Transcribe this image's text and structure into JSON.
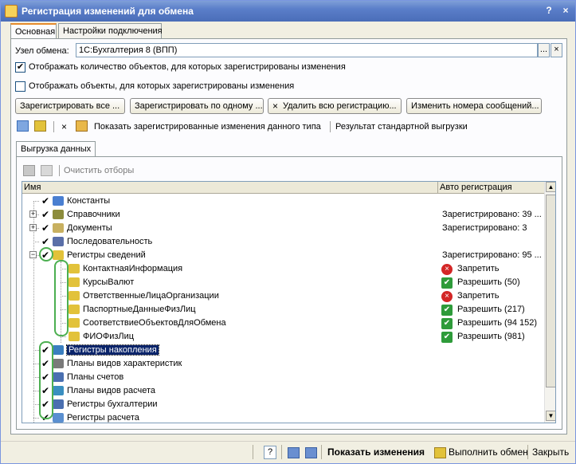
{
  "window": {
    "title": "Регистрация изменений для обмена",
    "controls": [
      "?",
      "×"
    ]
  },
  "tabs": [
    {
      "label": "Основная",
      "active": true
    },
    {
      "label": "Настройки подключения",
      "active": false
    }
  ],
  "main": {
    "node_label": "Узел обмена:",
    "node_value": "1С:Бухгалтерия 8 (ВПП)",
    "node_select_glyph": "...",
    "node_clear_glyph": "×",
    "chk_show_count": {
      "label": "Отображать количество объектов, для которых зарегистрированы изменения",
      "checked": true
    },
    "chk_show_objects": {
      "label": "Отображать объекты, для которых зарегистрированы изменения",
      "checked": false
    },
    "buttons": {
      "register_all": "Зарегистрировать все ...",
      "register_one": "Зарегистрировать по одному ...",
      "delete_all": "Удалить всю регистрацию...",
      "change_numbers": "Изменить номера сообщений..."
    },
    "toolbar2": {
      "delete_glyph": "×",
      "show_registered": "Показать зарегистрированные изменения данного типа",
      "std_result": "Результат стандартной выгрузки"
    },
    "subtab_label": "Выгрузка данных",
    "clear_filters": "Очистить отборы",
    "grid": {
      "col_name": "Имя",
      "col_auto": "Авто регистрация",
      "rows": [
        {
          "name": "Константы",
          "status": "",
          "level": 0,
          "expander": "",
          "icon_color": "#4a7fd1"
        },
        {
          "name": "Справочники",
          "status": "Зарегистрировано: 39 ...",
          "level": 0,
          "expander": "+",
          "icon_color": "#8c8c3c"
        },
        {
          "name": "Документы",
          "status": "Зарегистрировано: 3",
          "level": 0,
          "expander": "+",
          "icon_color": "#c8b060"
        },
        {
          "name": "Последовательность",
          "status": "",
          "level": 0,
          "expander": "",
          "icon_color": "#5a6fa8"
        },
        {
          "name": "Регистры сведений",
          "status": "Зарегистрировано: 95 ...",
          "level": 0,
          "expander": "-",
          "icon_color": "#e2c23a"
        },
        {
          "name": "КонтактнаяИнформация",
          "auto": "Запретить",
          "kind": "deny",
          "level": 1,
          "icon_color": "#e2c23a"
        },
        {
          "name": "КурсыВалют",
          "auto": "Разрешить (50)",
          "kind": "allow",
          "level": 1,
          "icon_color": "#e2c23a"
        },
        {
          "name": "ОтветственныеЛицаОрганизации",
          "auto": "Запретить",
          "kind": "deny",
          "level": 1,
          "icon_color": "#e2c23a"
        },
        {
          "name": "ПаспортныеДанныеФизЛиц",
          "auto": "Разрешить (217)",
          "kind": "allow",
          "level": 1,
          "icon_color": "#e2c23a"
        },
        {
          "name": "СоответствиеОбъектовДляОбмена",
          "auto": "Разрешить (94 152)",
          "kind": "allow",
          "level": 1,
          "icon_color": "#e2c23a"
        },
        {
          "name": "ФИОФизЛиц",
          "auto": "Разрешить (981)",
          "kind": "allow",
          "level": 1,
          "icon_color": "#e2c23a"
        },
        {
          "name": "Регистры накопления",
          "status": "",
          "level": 0,
          "expander": "",
          "selected": true,
          "icon_color": "#3a7fc0"
        },
        {
          "name": "Планы видов характеристик",
          "status": "",
          "level": 0,
          "expander": "",
          "icon_color": "#7a7a7a"
        },
        {
          "name": "Планы счетов",
          "status": "",
          "level": 0,
          "expander": "",
          "icon_color": "#4a6fb0"
        },
        {
          "name": "Планы видов расчета",
          "status": "",
          "level": 0,
          "expander": "",
          "icon_color": "#3a8fc0"
        },
        {
          "name": "Регистры бухгалтерии",
          "status": "",
          "level": 0,
          "expander": "",
          "icon_color": "#4a6fb0"
        },
        {
          "name": "Регистры расчета",
          "status": "",
          "level": 0,
          "expander": "",
          "icon_color": "#5a8fd0"
        }
      ]
    }
  },
  "status_bar": {
    "help_glyph": "?",
    "show_changes": "Показать изменения",
    "run_exchange": "Выполнить обмен",
    "close": "Закрыть"
  }
}
